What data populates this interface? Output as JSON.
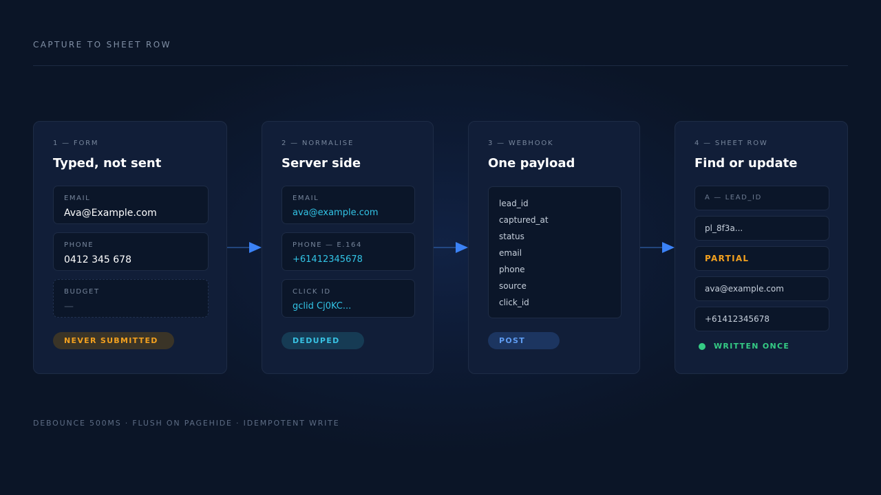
{
  "header": {
    "eyebrow": "CAPTURE TO SHEET ROW"
  },
  "footer": {
    "text": "DEBOUNCE 500MS · FLUSH ON PAGEHIDE · IDEMPOTENT WRITE"
  },
  "colors": {
    "background": "#0b1527",
    "card": "#111e38",
    "accent_blue": "#3b82f6",
    "orange": "#f3a11f",
    "cyan": "#32c4e6",
    "green": "#35cc85"
  },
  "cards": [
    {
      "step": "1 — FORM",
      "title": "Typed, not sent",
      "fields": [
        {
          "label": "EMAIL",
          "value": "Ava@Example.com"
        },
        {
          "label": "PHONE",
          "value": "0412 345 678"
        },
        {
          "label": "BUDGET",
          "value": "—"
        }
      ],
      "pill": "NEVER SUBMITTED"
    },
    {
      "step": "2 — NORMALISE",
      "title": "Server side",
      "fields": [
        {
          "label": "EMAIL",
          "value": "ava@example.com"
        },
        {
          "label": "PHONE — E.164",
          "value": "+61412345678"
        },
        {
          "label": "CLICK ID",
          "value": "gclid Cj0KC..."
        }
      ],
      "pill": "DEDUPED"
    },
    {
      "step": "3 — WEBHOOK",
      "title": "One payload",
      "payload": [
        "lead_id",
        "captured_at",
        "status",
        "email",
        "phone",
        "source",
        "click_id"
      ],
      "pill": "POST"
    },
    {
      "step": "4 — SHEET ROW",
      "title": "Find or update",
      "rows": [
        "A — LEAD_ID",
        "pl_8f3a...",
        "PARTIAL",
        "ava@example.com",
        "+61412345678"
      ],
      "status": "WRITTEN ONCE"
    }
  ]
}
